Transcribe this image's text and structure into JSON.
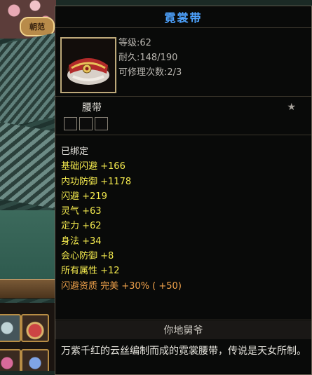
{
  "scene": {
    "emblem_text": "朝范"
  },
  "item": {
    "name": "霓裳带",
    "title_color": "#4ea3ff",
    "level_label": "等级:62",
    "durability_label": "耐久:148/190",
    "repair_label": "可修理次数:2/3",
    "type": "腰带",
    "star_icon": "star-icon",
    "bound": "已绑定",
    "attributes": [
      "基础闪避 +166",
      "内功防御 +1178",
      "闪避 +219",
      "灵气 +63",
      "定力 +62",
      "身法 +34",
      "会心防御 +8",
      "所有属性 +12"
    ],
    "quality_line": "闪避资质  完美 +30% ( +50)",
    "source": "你地舅爷",
    "description": "万紫千红的云丝编制而成的霓裳腰带，传说是天女所制。"
  }
}
